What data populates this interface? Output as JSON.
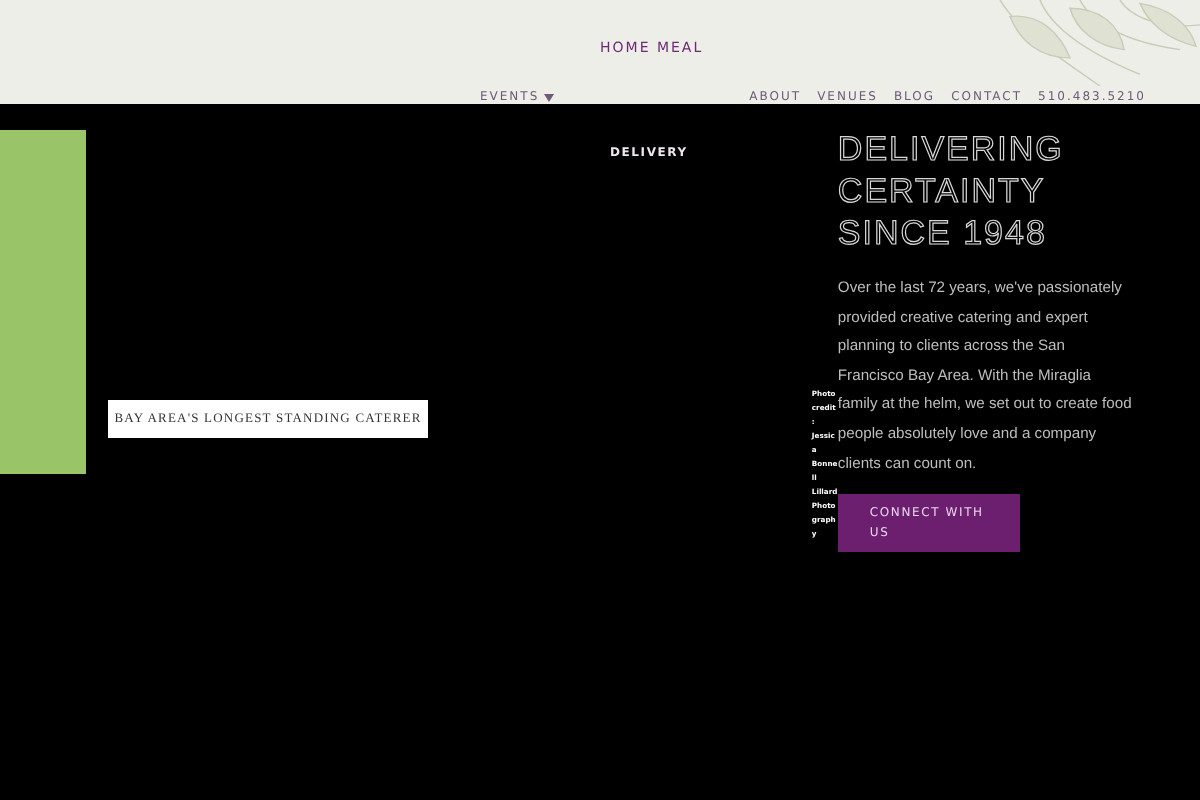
{
  "header": {
    "brand_line": "HOME MEAL",
    "nav": [
      {
        "label": "EVENTS",
        "dropdown": true
      },
      {
        "label": "ABOUT",
        "dropdown": false
      },
      {
        "label": "VENUES",
        "dropdown": false
      },
      {
        "label": "BLOG",
        "dropdown": false
      },
      {
        "label": "CONTACT",
        "dropdown": false
      },
      {
        "label": "510.483.5210",
        "dropdown": false
      }
    ]
  },
  "hero": {
    "tagline": "BAY AREA'S LONGEST STANDING CATERER",
    "delivery_label": "DELIVERY",
    "photo_credit": "Photo credit: Jessica Bonnell Lillard Photography",
    "heading": [
      "DELIVERING",
      "CERTAINTY",
      "SINCE 1948"
    ],
    "body": "Over the last 72 years, we've passionately provided creative catering and expert planning to clients across the San Francisco Bay Area. With the Miraglia family at the helm, we set out to create food people absolutely love and a company clients can count on.",
    "button": "CONNECT WITH US"
  }
}
